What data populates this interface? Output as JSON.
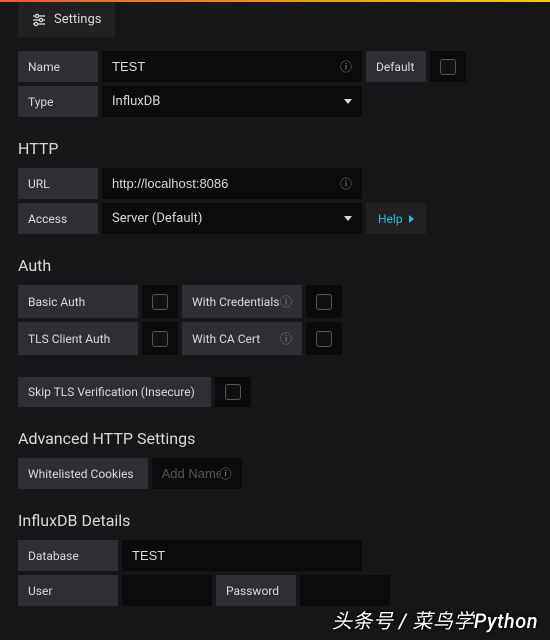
{
  "tab": {
    "label": "Settings"
  },
  "basic": {
    "name_label": "Name",
    "name_value": "TEST",
    "default_label": "Default",
    "type_label": "Type",
    "type_value": "InfluxDB"
  },
  "http": {
    "title": "HTTP",
    "url_label": "URL",
    "url_value": "http://localhost:8086",
    "access_label": "Access",
    "access_value": "Server (Default)",
    "help_label": "Help"
  },
  "auth": {
    "title": "Auth",
    "basic_auth": "Basic Auth",
    "with_credentials": "With Credentials",
    "tls_client_auth": "TLS Client Auth",
    "with_ca_cert": "With CA Cert",
    "skip_tls": "Skip TLS Verification (Insecure)"
  },
  "advanced": {
    "title": "Advanced HTTP Settings",
    "whitelisted_label": "Whitelisted Cookies",
    "whitelisted_placeholder": "Add Name"
  },
  "influx": {
    "title": "InfluxDB Details",
    "database_label": "Database",
    "database_value": "TEST",
    "user_label": "User",
    "password_label": "Password"
  },
  "watermark": "头条号 / 菜鸟学Python"
}
